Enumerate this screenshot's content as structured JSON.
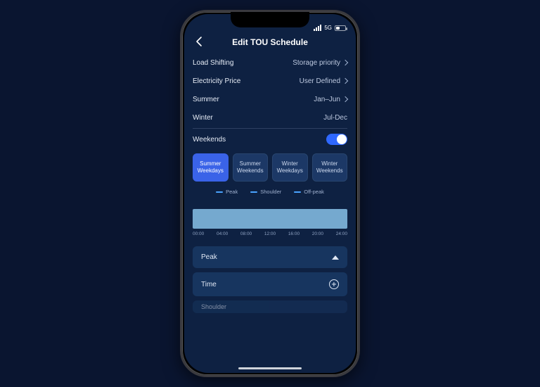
{
  "status": {
    "network": "5G"
  },
  "header": {
    "title": "Edit TOU Schedule"
  },
  "rows": {
    "loadShifting": {
      "label": "Load Shifting",
      "value": "Storage priority"
    },
    "electricityPrice": {
      "label": "Electricity Price",
      "value": "User Defined"
    },
    "summer": {
      "label": "Summer",
      "value": "Jan–Jun"
    },
    "winter": {
      "label": "Winter",
      "value": "Jul-Dec"
    },
    "weekends": {
      "label": "Weekends",
      "enabled": true
    }
  },
  "tabs": [
    {
      "label": "Summer\nWeekdays",
      "active": true
    },
    {
      "label": "Summer\nWeekends",
      "active": false
    },
    {
      "label": "Winter\nWeekdays",
      "active": false
    },
    {
      "label": "Winter\nWeekends",
      "active": false
    }
  ],
  "legend": [
    {
      "label": "Peak"
    },
    {
      "label": "Shoulder"
    },
    {
      "label": "Off-peak"
    }
  ],
  "timeline": {
    "ticks": [
      "00:00",
      "04:00",
      "08:00",
      "12:00",
      "16:00",
      "20:00",
      "24:00"
    ]
  },
  "cards": {
    "peak": "Peak",
    "time": "Time",
    "shoulder": "Shoulder"
  }
}
